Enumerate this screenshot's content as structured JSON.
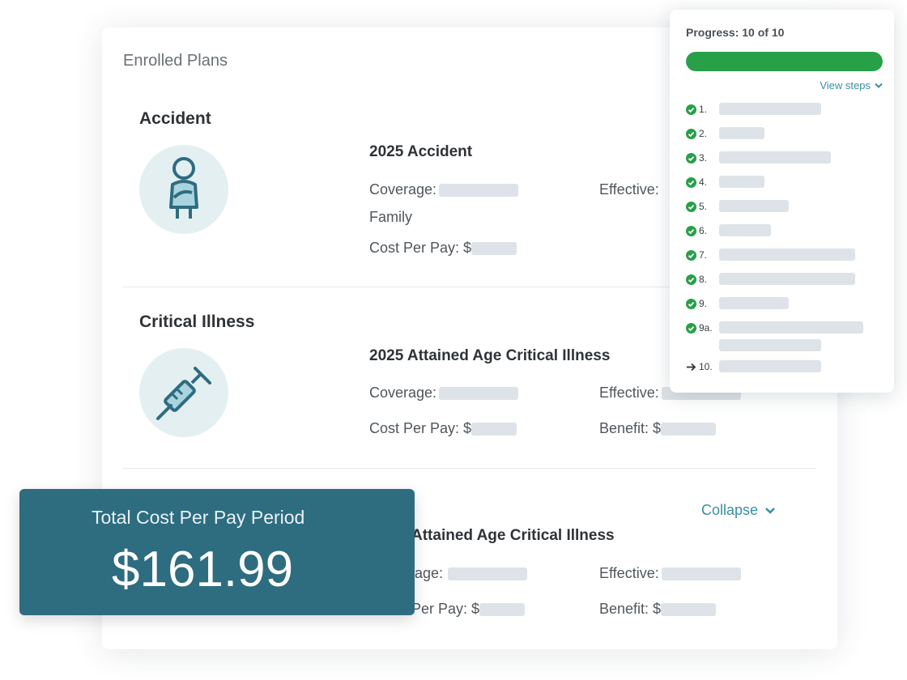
{
  "enrolled": {
    "title": "Enrolled Plans",
    "plans": [
      {
        "name": "Accident",
        "icon": "person-injury-icon",
        "title": "2025 Accident",
        "coverage_label": "Coverage:",
        "coverage_value": "Family",
        "effective_label": "Effective:",
        "cost_label": "Cost Per Pay: $"
      },
      {
        "name": "Critical Illness",
        "icon": "syringe-icon",
        "title": "2025 Attained Age Critical Illness",
        "coverage_label": "Coverage:",
        "effective_label": "Effective:",
        "cost_label": "Cost Per Pay: $",
        "benefit_label": "Benefit: $"
      },
      {
        "title": "Attained Age Critical Illness",
        "coverage_label": "age:",
        "effective_label": "Effective:",
        "cost_label": "Per Pay: $",
        "benefit_label": "Benefit: $"
      }
    ],
    "collapse_label": "Collapse"
  },
  "total": {
    "label": "Total Cost Per Pay Period",
    "value": "$161.99"
  },
  "progress": {
    "label": "Progress: 10 of 10",
    "current": 10,
    "total": 10,
    "fill_color": "#27a047",
    "view_steps_label": "View steps",
    "steps": [
      {
        "num": "1.",
        "status": "done"
      },
      {
        "num": "2.",
        "status": "done"
      },
      {
        "num": "3.",
        "status": "done"
      },
      {
        "num": "4.",
        "status": "done"
      },
      {
        "num": "5.",
        "status": "done"
      },
      {
        "num": "6.",
        "status": "done"
      },
      {
        "num": "7.",
        "status": "done"
      },
      {
        "num": "8.",
        "status": "done"
      },
      {
        "num": "9.",
        "status": "done"
      },
      {
        "num": "9a.",
        "status": "done"
      },
      {
        "num": "10.",
        "status": "current"
      }
    ]
  },
  "colors": {
    "accent": "#3b8ea5",
    "total_bg": "#2e6c80",
    "complete": "#27a047"
  }
}
